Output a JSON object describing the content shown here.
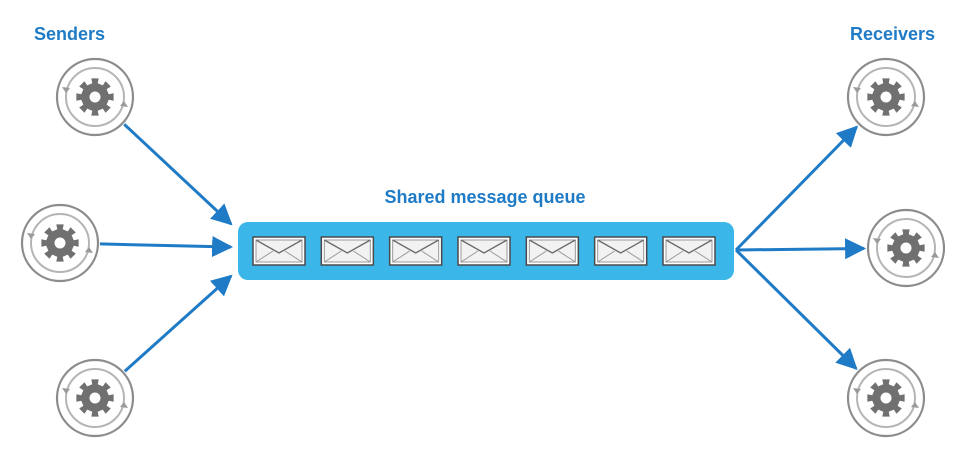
{
  "labels": {
    "senders": "Senders",
    "receivers": "Receivers",
    "queue_title": "Shared message queue"
  },
  "colors": {
    "accent": "#1f7bc6",
    "queue_fill": "#3ab6e8",
    "node_ring": "#8c8c8c",
    "gear": "#707070"
  },
  "icons": {
    "node": "gear-icon",
    "message": "envelope-icon"
  },
  "senders": [
    {
      "id": "sender-1"
    },
    {
      "id": "sender-2"
    },
    {
      "id": "sender-3"
    }
  ],
  "receivers": [
    {
      "id": "receiver-1"
    },
    {
      "id": "receiver-2"
    },
    {
      "id": "receiver-3"
    }
  ],
  "queue": {
    "message_count": 7
  }
}
